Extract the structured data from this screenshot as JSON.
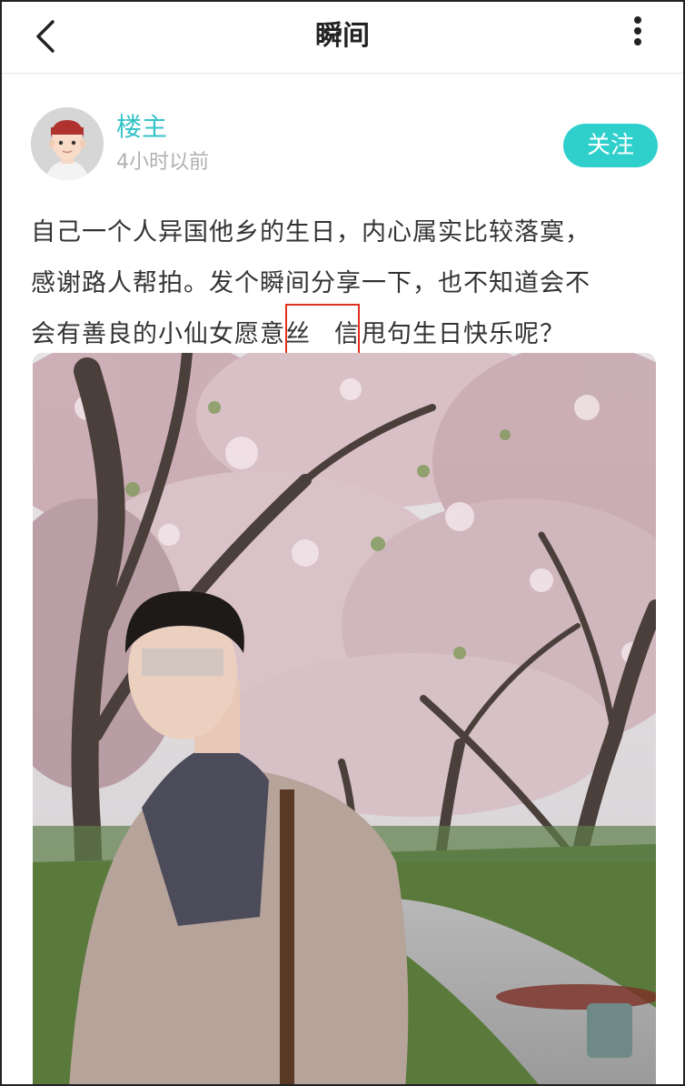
{
  "header": {
    "title": "瞬间"
  },
  "post": {
    "author": "楼主",
    "time": "4小时以前",
    "follow_label": "关注",
    "text_lines": {
      "l1": "自己一个人异国他乡的生日，内心属实比较落寞，",
      "l2": "感谢路人帮拍。发个瞬间分享一下，也不知道会不",
      "l3_before": "会有善良的小仙女愿意",
      "l3_hl_a": "丝",
      "l3_hl_b": "信",
      "l3_after": "甩句生日快乐呢？"
    }
  },
  "colors": {
    "accent": "#2fd0cc",
    "username": "#35c3c8",
    "highlight_border": "#e0301e"
  }
}
